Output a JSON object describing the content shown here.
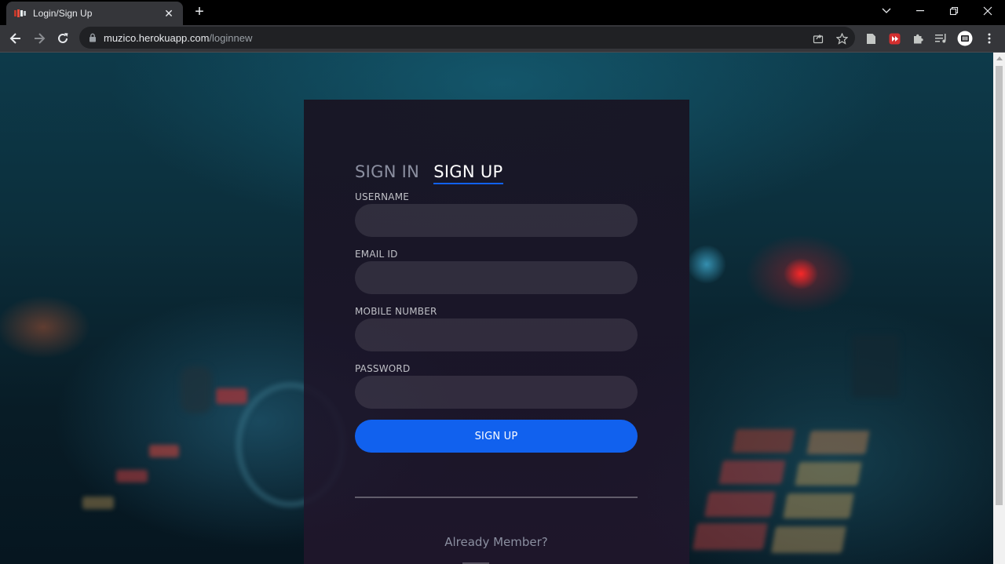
{
  "browser": {
    "tab_title": "Login/Sign Up",
    "url_host": "muzico.herokuapp.com",
    "url_path": "/loginnew"
  },
  "auth": {
    "tabs": [
      {
        "label": "SIGN IN",
        "active": false
      },
      {
        "label": "SIGN UP",
        "active": true
      }
    ],
    "fields": [
      {
        "label": "USERNAME",
        "value": ""
      },
      {
        "label": "EMAIL ID",
        "value": ""
      },
      {
        "label": "MOBILE NUMBER",
        "value": ""
      },
      {
        "label": "PASSWORD",
        "value": ""
      }
    ],
    "submit_label": "SIGN UP",
    "footer_link": "Already Member?"
  },
  "colors": {
    "accent": "#1161ee",
    "card_bg": "#1a1622",
    "chrome_bg": "#35363a"
  }
}
